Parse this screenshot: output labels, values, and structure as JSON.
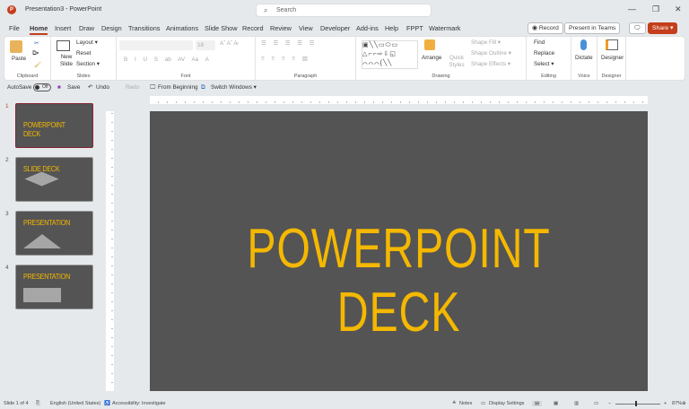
{
  "app": {
    "title": "Presentation3 - PowerPoint",
    "logo": "P",
    "search_placeholder": "Search"
  },
  "window": {
    "minimize": "—",
    "restore": "❐",
    "close": "✕"
  },
  "tabs": [
    "File",
    "Home",
    "Insert",
    "Draw",
    "Design",
    "Transitions",
    "Animations",
    "Slide Show",
    "Record",
    "Review",
    "View",
    "Developer",
    "Add-ins",
    "Help",
    "FPPT",
    "Watermark"
  ],
  "active_tab": "Home",
  "header_buttons": {
    "record": "◉ Record",
    "teams": "Present in Teams",
    "comments": "🗨",
    "share": "Share ▾"
  },
  "ribbon": {
    "clipboard": {
      "label": "Clipboard",
      "paste": "Paste"
    },
    "slides": {
      "label": "Slides",
      "new_slide": "New Slide",
      "layout": "Layout ▾",
      "reset": "Reset",
      "section": "Section ▾"
    },
    "font": {
      "label": "Font",
      "size": "18",
      "buttons": [
        "B",
        "I",
        "U",
        "S",
        "ab",
        "AV",
        "Aa",
        "A"
      ]
    },
    "paragraph": {
      "label": "Paragraph"
    },
    "drawing": {
      "label": "Drawing",
      "arrange": "Arrange",
      "quick_styles": "Quick Styles",
      "shape_fill": "Shape Fill ▾",
      "shape_outline": "Shape Outline ▾",
      "shape_effects": "Shape Effects ▾"
    },
    "editing": {
      "label": "Editing",
      "find": "Find",
      "replace": "Replace",
      "select": "Select ▾"
    },
    "voice": {
      "label": "Voice",
      "dictate": "Dictate"
    },
    "designer": {
      "label": "Designer",
      "designer": "Designer"
    }
  },
  "qat": {
    "autosave": "AutoSave",
    "toggle": "Off",
    "save": "Save",
    "undo": "Undo",
    "redo": "Redo",
    "from_beginning": "From Beginning",
    "switch_windows": "Switch Windows ▾"
  },
  "thumbnails": [
    {
      "num": "1",
      "title": "POWERPOINT DECK",
      "shape": "none"
    },
    {
      "num": "2",
      "title": "SLIDE DECK",
      "shape": "diamond"
    },
    {
      "num": "3",
      "title": "PRESENTATION",
      "shape": "triangle"
    },
    {
      "num": "4",
      "title": "PRESENTATION",
      "shape": "rectangle"
    }
  ],
  "slide": {
    "title": "POWERPOINT DECK",
    "background": "#545454",
    "text_color": "#f4b800"
  },
  "status": {
    "slide": "Slide 1 of 4",
    "language": "English (United States)",
    "accessibility": "Accessibility: Investigate",
    "notes": "Notes",
    "display": "Display Settings",
    "zoom": "87%",
    "zoom_level": 87
  }
}
